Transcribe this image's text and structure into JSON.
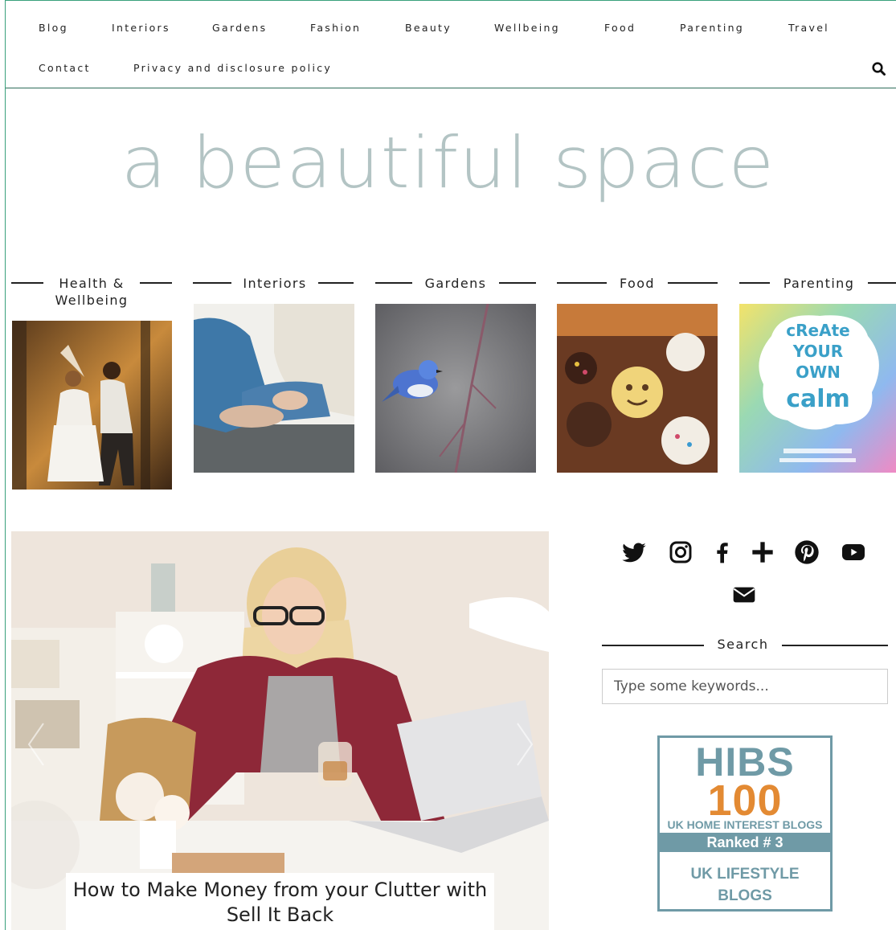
{
  "nav": {
    "row1": [
      "Blog",
      "Interiors",
      "Gardens",
      "Fashion",
      "Beauty",
      "Wellbeing",
      "Food",
      "Parenting",
      "Travel"
    ],
    "row2": [
      "Contact",
      "Privacy and disclosure policy"
    ]
  },
  "logo": {
    "text": "a beautiful space"
  },
  "categories": [
    {
      "line1": "Health &",
      "line2": "Wellbeing"
    },
    {
      "line1": "Interiors",
      "line2": ""
    },
    {
      "line1": "Gardens",
      "line2": ""
    },
    {
      "line1": "Food",
      "line2": ""
    },
    {
      "line1": "Parenting",
      "line2": ""
    }
  ],
  "featured": {
    "caption_line1": "How to Make Money from your Clutter with",
    "caption_line2": "Sell It Back"
  },
  "sidebar": {
    "social_icons": [
      "twitter-icon",
      "instagram-icon",
      "facebook-icon",
      "plus-icon",
      "pinterest-icon",
      "youtube-icon",
      "email-icon"
    ],
    "search_title": "Search",
    "search_placeholder": "Type some keywords...",
    "badge": {
      "title": "HIBS",
      "number": "100",
      "subtitle": "UK HOME INTEREST BLOGS",
      "rank": "Ranked # 3",
      "category_line1": "UK LIFESTYLE",
      "category_line2": "BLOGS"
    }
  },
  "colors": {
    "frame": "#39a07c",
    "logo": "#b3c4c4",
    "badge_blue": "#6f9aa6",
    "badge_orange": "#e38a33"
  }
}
